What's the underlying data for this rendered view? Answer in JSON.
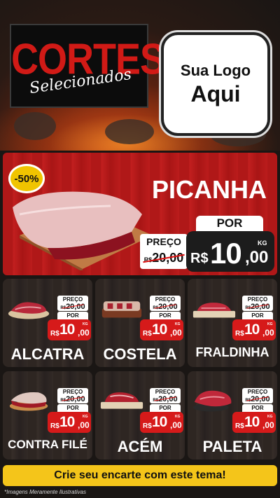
{
  "brand": {
    "title_main": "CORTES",
    "title_script": "Selecionados",
    "logo_line1": "Sua Logo",
    "logo_line2": "Aqui"
  },
  "featured": {
    "discount": "-50%",
    "name": "PICANHA",
    "old_label": "PREÇO",
    "old_currency": "R$",
    "old_price": "20,00",
    "new_label": "POR",
    "currency": "R$",
    "price_int": "10",
    "price_dec": ",00",
    "unit": "KG"
  },
  "products": [
    {
      "name": "ALCATRA",
      "old_label": "PREÇO",
      "old_currency": "R$",
      "old_price": "20,00",
      "new_label": "POR",
      "currency": "R$",
      "price_int": "10",
      "price_dec": ",00",
      "unit": "KG"
    },
    {
      "name": "COSTELA",
      "old_label": "PREÇO",
      "old_currency": "R$",
      "old_price": "20,00",
      "new_label": "POR",
      "currency": "R$",
      "price_int": "10",
      "price_dec": ",00",
      "unit": "KG"
    },
    {
      "name": "FRALDINHA",
      "old_label": "PREÇO",
      "old_currency": "R$",
      "old_price": "20,00",
      "new_label": "POR",
      "currency": "R$",
      "price_int": "10",
      "price_dec": ",00",
      "unit": "KG"
    },
    {
      "name": "CONTRA FILÉ",
      "old_label": "PREÇO",
      "old_currency": "R$",
      "old_price": "20,00",
      "new_label": "POR",
      "currency": "R$",
      "price_int": "10",
      "price_dec": ",00",
      "unit": "KG"
    },
    {
      "name": "ACÉM",
      "old_label": "PREÇO",
      "old_currency": "R$",
      "old_price": "20,00",
      "new_label": "POR",
      "currency": "R$",
      "price_int": "10",
      "price_dec": ",00",
      "unit": "KG"
    },
    {
      "name": "PALETA",
      "old_label": "PREÇO",
      "old_currency": "R$",
      "old_price": "20,00",
      "new_label": "POR",
      "currency": "R$",
      "price_int": "10",
      "price_dec": ",00",
      "unit": "KG"
    }
  ],
  "cta": "Crie seu encarte com este tema!",
  "disclaimer": "*Imagens Meramente Ilustrativas",
  "colors": {
    "accent_red": "#d61a1a",
    "feature_red": "#b01818",
    "cta_yellow": "#f4c51a",
    "wood_dark": "#2b2421"
  }
}
